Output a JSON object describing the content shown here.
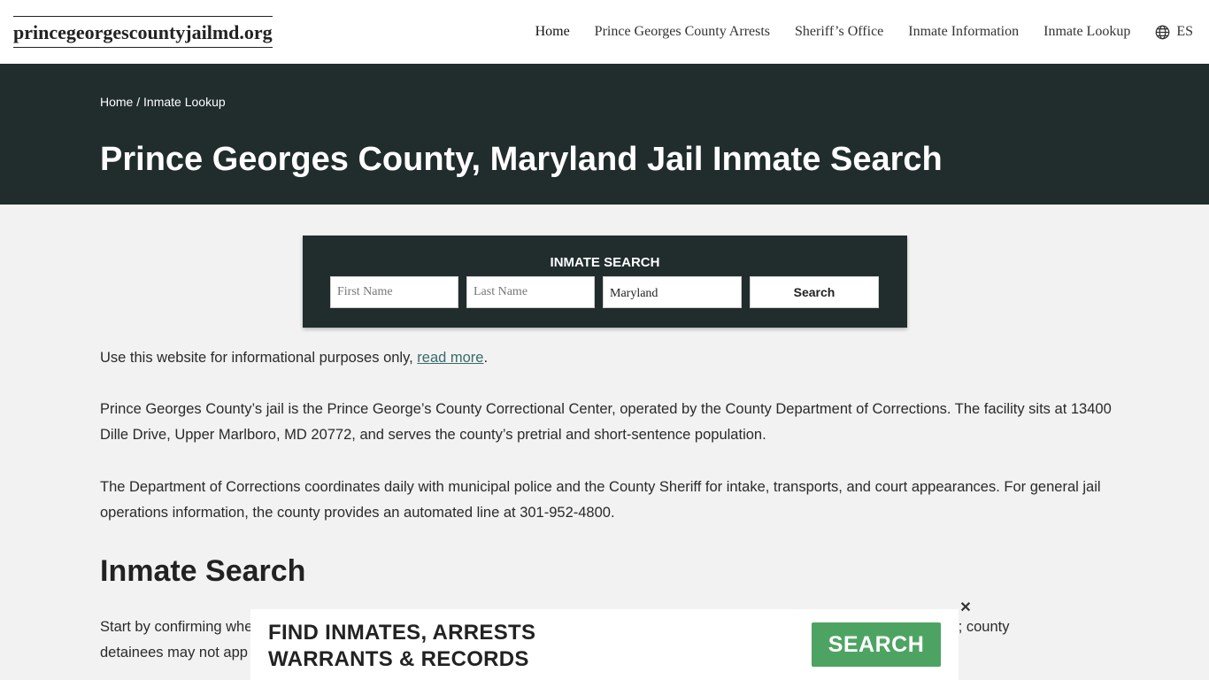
{
  "header": {
    "logo": "princegeorgescountyjailmd.org",
    "nav": [
      {
        "label": "Home"
      },
      {
        "label": "Prince Georges County Arrests"
      },
      {
        "label": "Sheriff’s Office"
      },
      {
        "label": "Inmate Information"
      },
      {
        "label": "Inmate Lookup"
      }
    ],
    "lang_label": "ES",
    "lang_icon": "globe-icon"
  },
  "hero": {
    "breadcrumb_home": "Home",
    "breadcrumb_sep": " / ",
    "breadcrumb_current": "Inmate Lookup",
    "title": "Prince Georges County, Maryland Jail Inmate Search"
  },
  "search": {
    "title": "INMATE SEARCH",
    "first_placeholder": "First Name",
    "last_placeholder": "Last Name",
    "state_value": "Maryland",
    "button_label": "Search"
  },
  "content": {
    "disclaimer_text": "Use this website for informational purposes only, ",
    "disclaimer_link": "read more",
    "disclaimer_end": ".",
    "p1": "Prince Georges County’s jail is the Prince George’s County Correctional Center, operated by the County Department of Corrections. The facility sits at 13400 Dille Drive, Upper Marlboro, MD 20772, and serves the county’s pretrial and short-sentence population.",
    "p2": "The Department of Corrections coordinates daily with municipal police and the County Sheriff for intake, transports, and court appearances. For general jail operations information, the county provides an automated line at 301-952-4800.",
    "h2": "Inmate Search",
    "p3_start": "Start by confirming whe",
    "p3_end": "e facilities only; county",
    "p3_line2": "detainees may not app"
  },
  "ad": {
    "line1": "FIND INMATES, ARRESTS",
    "line2": "WARRANTS & RECORDS",
    "button": "SEARCH",
    "close": "✕"
  },
  "colors": {
    "hero_bg": "#212c2d",
    "page_bg": "#f2f2f2",
    "ad_button": "#4da462",
    "link": "#3a6b6b"
  }
}
